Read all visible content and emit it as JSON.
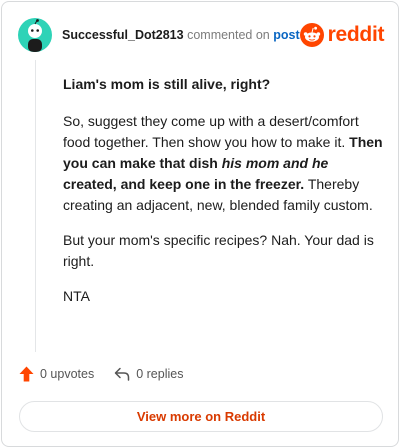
{
  "header": {
    "username": "Successful_Dot2813",
    "commented_on": "commented on",
    "post_link": "post",
    "brand": "reddit",
    "brand_color": "#ff4500"
  },
  "comment": {
    "question": "Liam's mom is still alive, right?",
    "para1": {
      "text1": "So, suggest they come up with a desert/comfort food together. Then show you how to make it. ",
      "bold1": "Then you can make that dish ",
      "bolditalic": "his mom and he",
      "bold2": " created, and keep one in the freezer.",
      "text2": " Thereby creating an adjacent, new, blended family custom."
    },
    "para2": "But your mom's specific recipes? Nah. Your dad is right.",
    "para3": "NTA"
  },
  "actions": {
    "upvotes": "0 upvotes",
    "replies": "0 replies"
  },
  "view_more": "View more on Reddit",
  "icons": {
    "avatar": "snoo-avatar-icon",
    "brand": "reddit-logo-icon",
    "upvote": "upvote-arrow-icon",
    "reply": "reply-arrow-icon"
  },
  "colors": {
    "avatar_bg": "#2ed3b7",
    "upvote": "#ff4500",
    "link": "#0a66c2",
    "view_more_text": "#d93a00"
  }
}
